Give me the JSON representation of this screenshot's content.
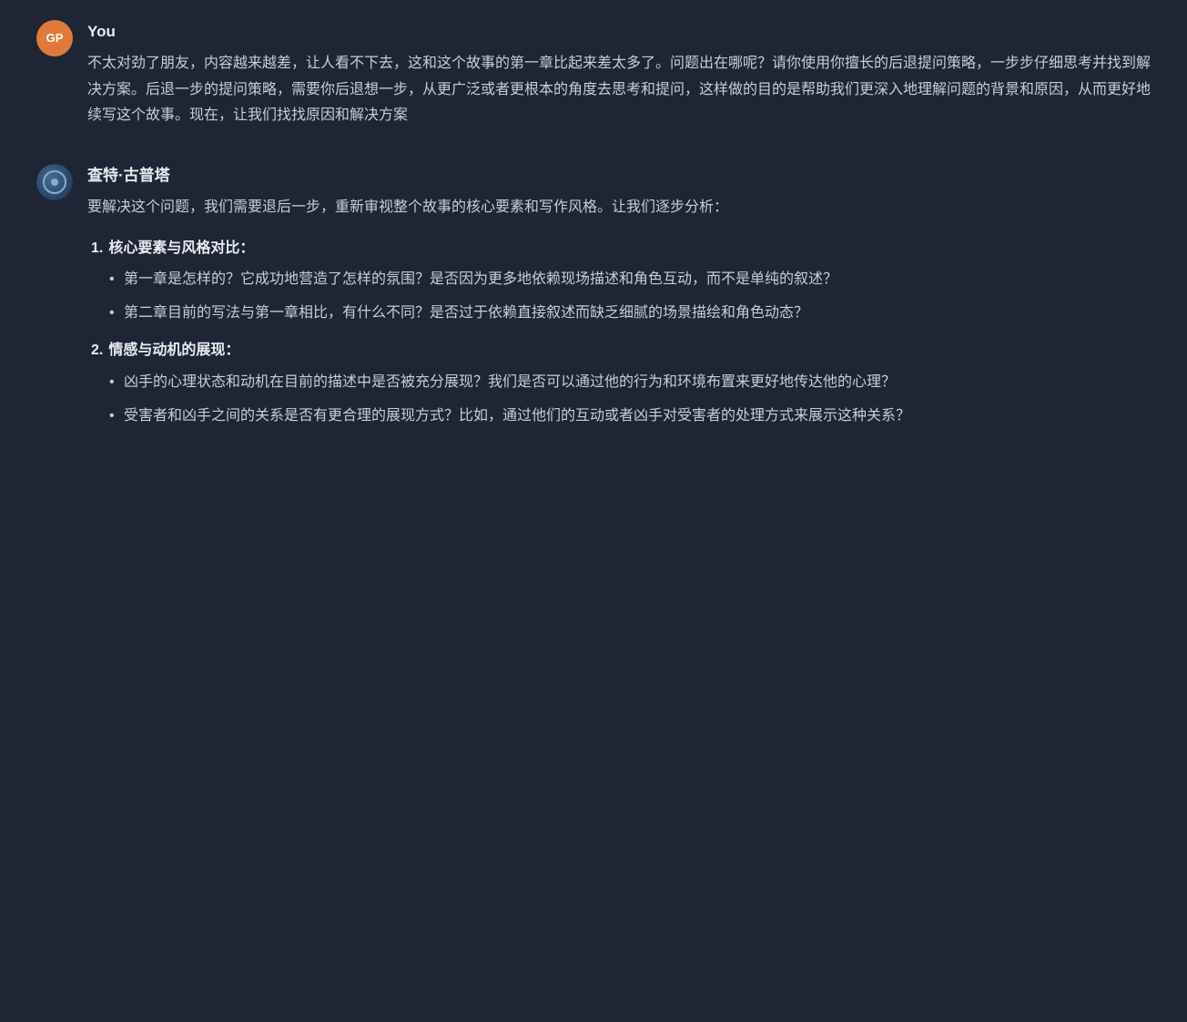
{
  "user": {
    "name": "You",
    "avatar_initials": "GP",
    "message": "不太对劲了朋友，内容越来越差，让人看不下去，这和这个故事的第一章比起来差太多了。问题出在哪呢？请你使用你擅长的后退提问策略，一步步仔细思考并找到解决方案。后退一步的提问策略，需要你后退想一步，从更广泛或者更根本的角度去思考和提问，这样做的目的是帮助我们更深入地理解问题的背景和原因，从而更好地续写这个故事。现在，让我们找找原因和解决方案"
  },
  "ai": {
    "name": "查特·古普塔",
    "intro": "要解决这个问题，我们需要退后一步，重新审视整个故事的核心要素和写作风格。让我们逐步分析：",
    "sections": [
      {
        "number": "1.",
        "title": "核心要素与风格对比",
        "colon": "：",
        "bullets": [
          "第一章是怎样的？它成功地营造了怎样的氛围？是否因为更多地依赖现场描述和角色互动，而不是单纯的叙述？",
          "第二章目前的写法与第一章相比，有什么不同？是否过于依赖直接叙述而缺乏细腻的场景描绘和角色动态？"
        ]
      },
      {
        "number": "2.",
        "title": "情感与动机的展现",
        "colon": "：",
        "bullets": [
          "凶手的心理状态和动机在目前的描述中是否被充分展现？我们是否可以通过他的行为和环境布置来更好地传达他的心理？",
          "受害者和凶手之间的关系是否有更合理的展现方式？比如，通过他们的互动或者凶手对受害者的处理方式来展示这种关系？"
        ]
      }
    ]
  },
  "colors": {
    "background": "#1e2535",
    "text": "#c8cdd6",
    "heading": "#e8ecf0",
    "accent": "#e07a3a"
  }
}
